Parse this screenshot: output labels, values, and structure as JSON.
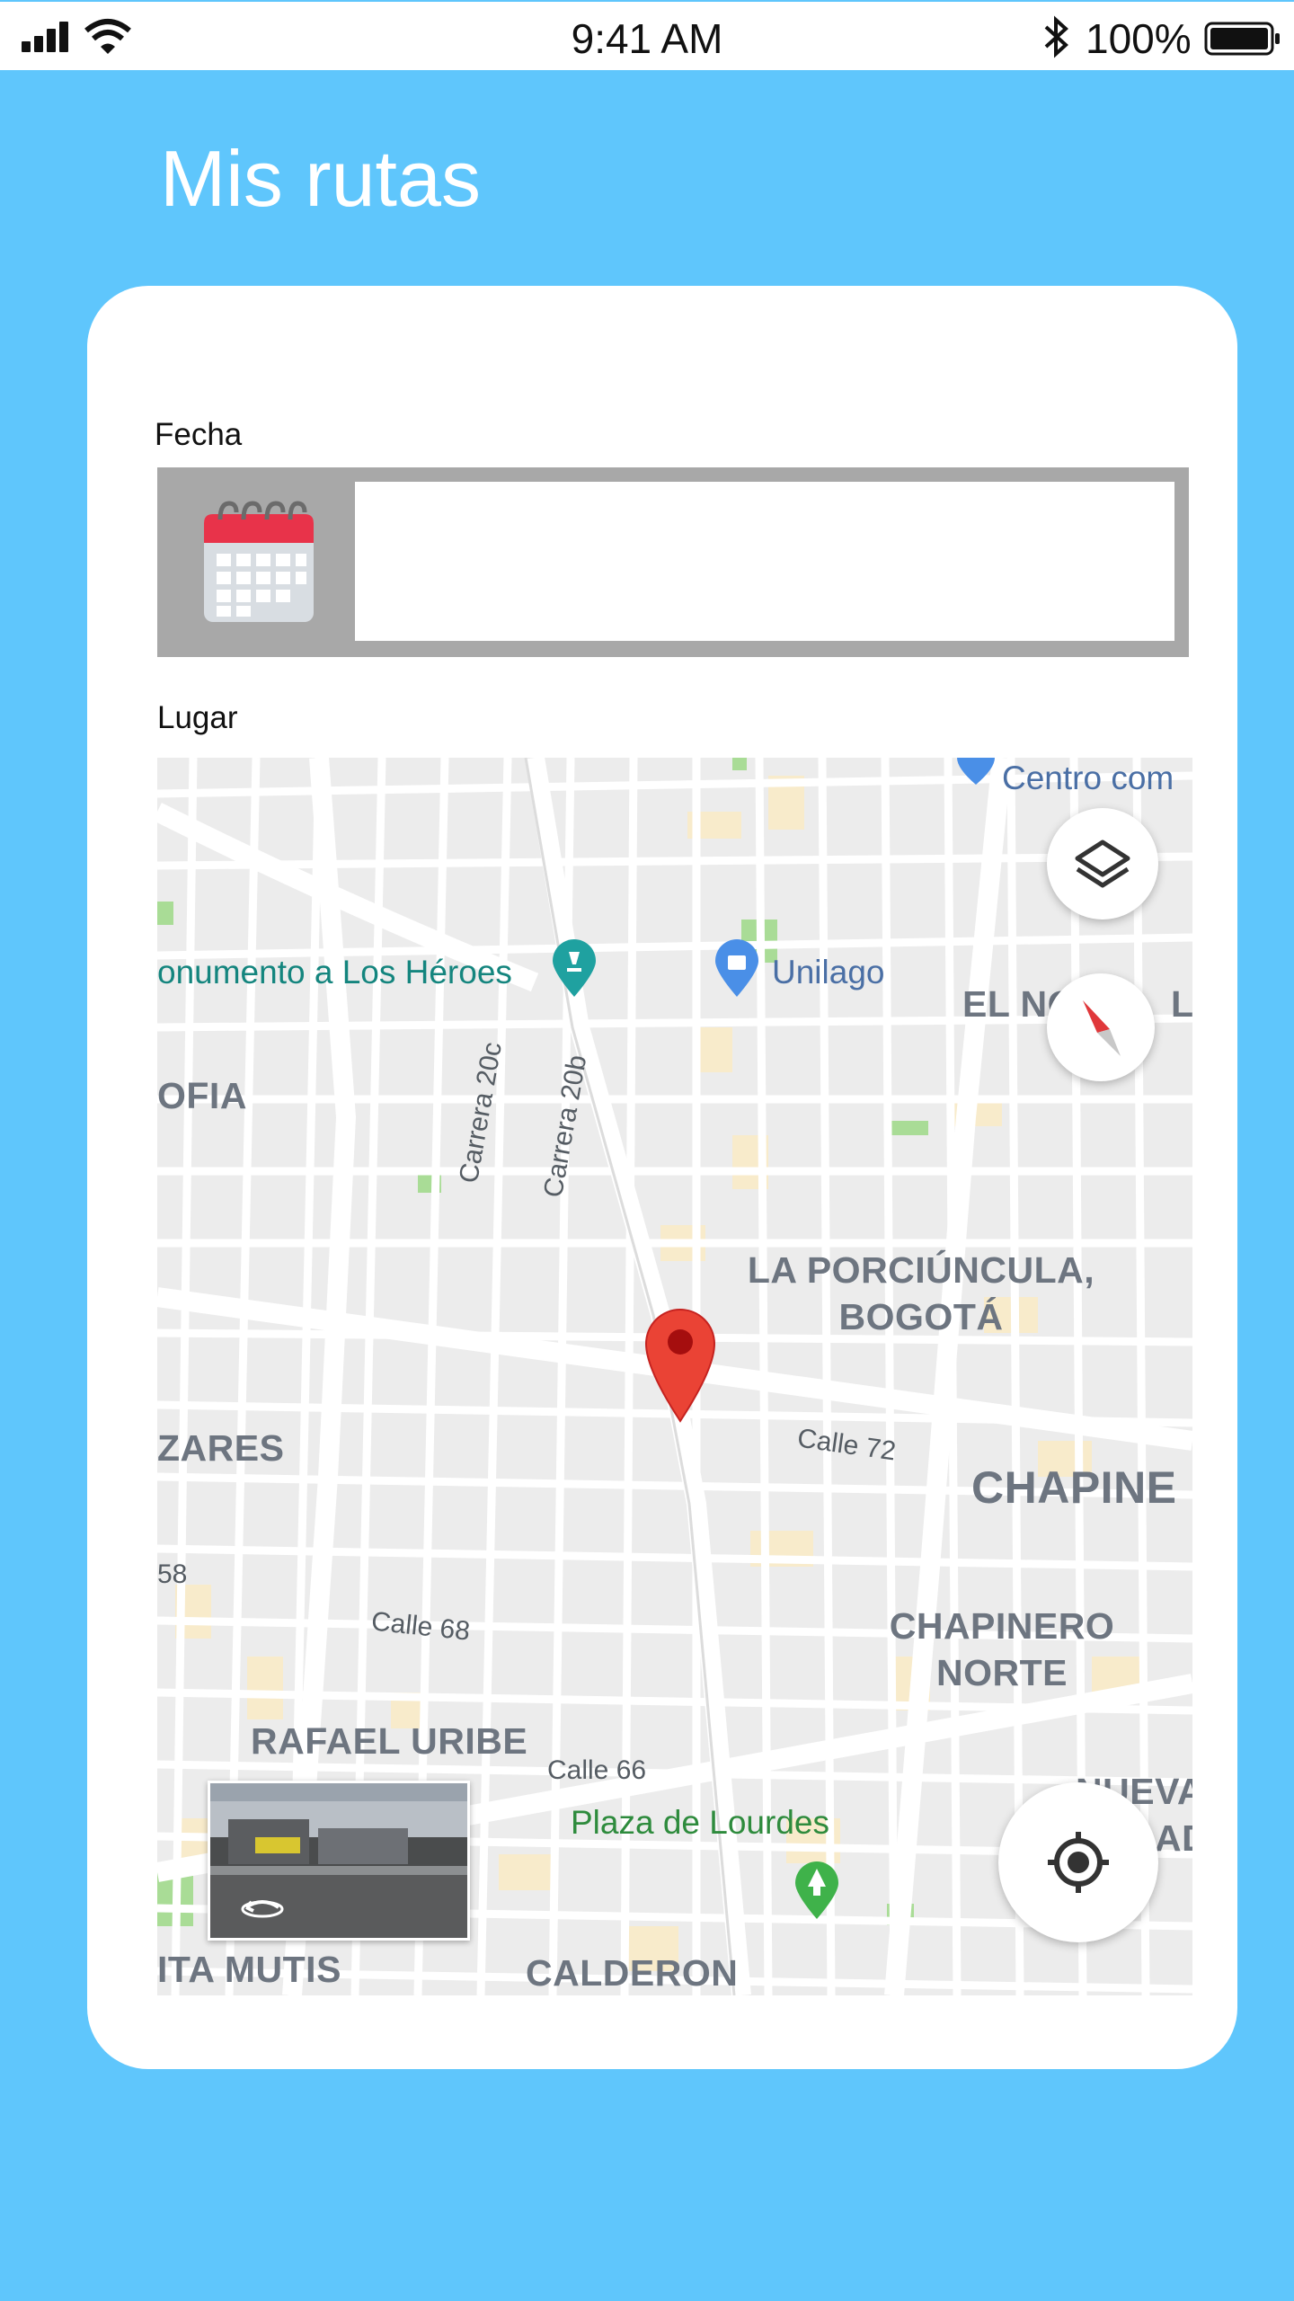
{
  "status_bar": {
    "time": "9:41 AM",
    "battery_percent": "100%",
    "icons": [
      "signal-icon",
      "wifi-icon",
      "bluetooth-icon",
      "battery-icon"
    ]
  },
  "page": {
    "title": "Mis rutas"
  },
  "form": {
    "date_label": "Fecha",
    "date_value": "",
    "place_label": "Lugar"
  },
  "map": {
    "districts": [
      "LA PORCIÚNCULA,",
      "BOGOTÁ",
      "CHAPINE",
      "CHAPINERO",
      "NORTE",
      "RAFAEL URIBE",
      "CALDERON",
      "ITA MUTIS",
      "ZARES",
      "OFIA",
      "EL NO",
      "NUEVA",
      "AD",
      "L"
    ],
    "streets": [
      "Carrera 20c",
      "Carrera 20b",
      "Calle 72",
      "Calle 68",
      "Calle 66",
      "58"
    ],
    "pois": [
      "onumento a Los Héroes",
      "Unilago",
      "Centro com",
      "Plaza de Lourdes"
    ]
  },
  "colors": {
    "background": "#5fc6fc",
    "card": "#ffffff",
    "pin": "#ea4335"
  }
}
